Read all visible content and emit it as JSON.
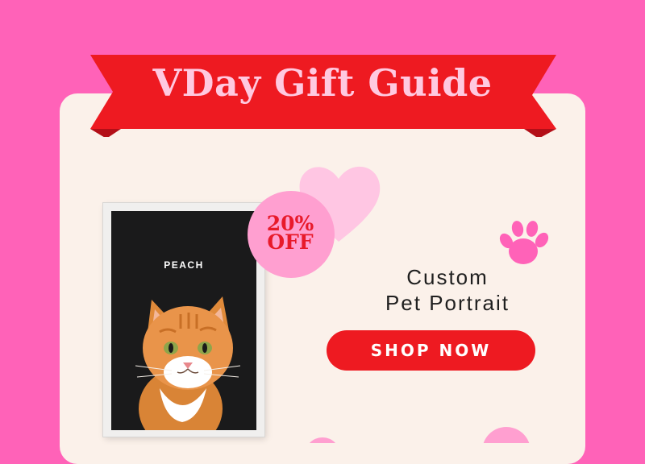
{
  "banner": {
    "title": "VDay Gift Guide"
  },
  "product": {
    "pet_name": "PEACH",
    "discount_line1": "20%",
    "discount_line2": "OFF",
    "name_line1": "Custom",
    "name_line2": "Pet Portrait"
  },
  "cta": {
    "label": "SHOP NOW"
  },
  "icons": [
    "heart-icon",
    "paw-print-icon",
    "cat-illustration"
  ],
  "colors": {
    "background": "#ff62b8",
    "card": "#fbf1ea",
    "ribbon": "#ee1a21",
    "title_text": "#ffc9e0",
    "badge": "#ff9fd0",
    "button": "#ee1a21",
    "paw": "#ff62b8"
  }
}
